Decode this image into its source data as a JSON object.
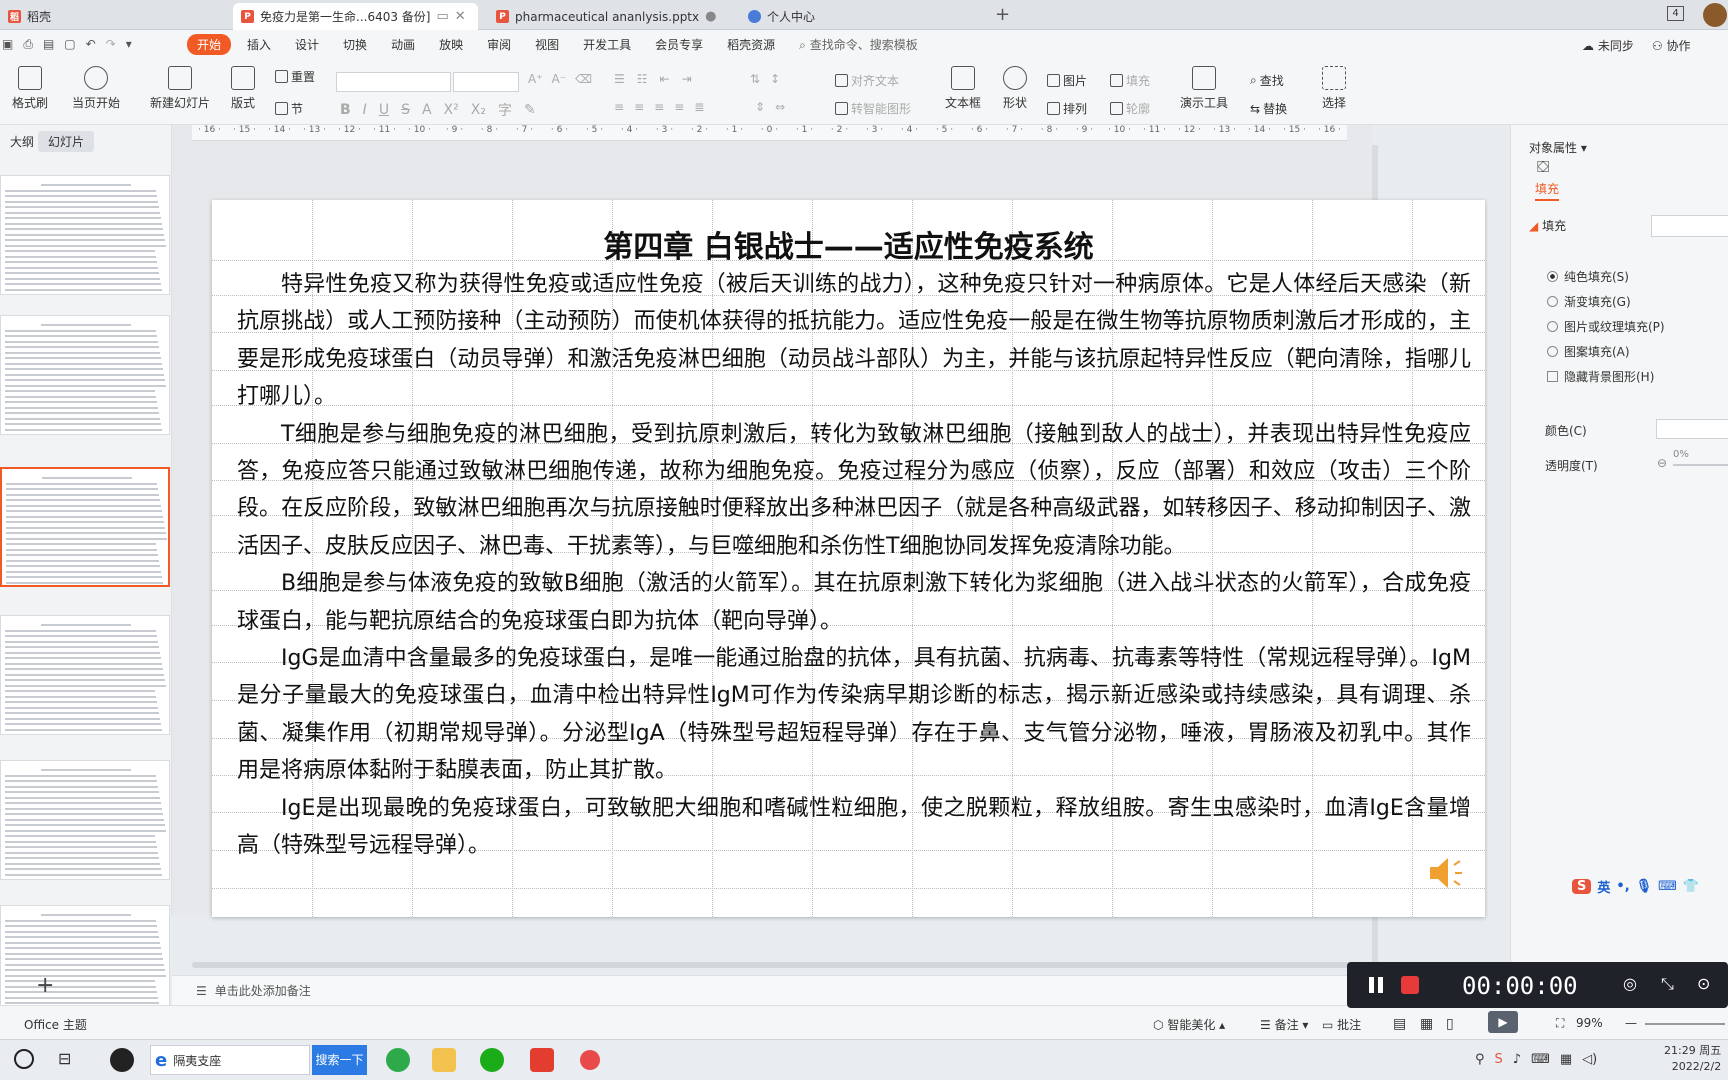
{
  "tabs": [
    {
      "label": "稻壳"
    },
    {
      "label": "免疫力是第一生命...6403 备份]"
    },
    {
      "label": "pharmaceutical ananlysis.pptx"
    },
    {
      "label": "个人中心"
    }
  ],
  "tab_count_badge": "4",
  "menu": [
    "开始",
    "插入",
    "设计",
    "切换",
    "动画",
    "放映",
    "审阅",
    "视图",
    "开发工具",
    "会员专享",
    "稻壳资源"
  ],
  "search_placeholder": "查找命令、搜索模板",
  "sync_label": "未同步",
  "collab_label": "协作",
  "ribbon": {
    "format_brush": "格式刷",
    "from_current": "当页开始",
    "new_slide": "新建幻灯片",
    "layout": "版式",
    "section": "节",
    "reset": "重置",
    "align_text": "对齐文本",
    "smart_shape": "转智能图形",
    "textbox": "文本框",
    "shape": "形状",
    "picture": "图片",
    "fill": "填充",
    "arrange": "排列",
    "outline": "轮廓",
    "present_tools": "演示工具",
    "find": "查找",
    "replace": "替换",
    "select": "选择"
  },
  "left_tabs": [
    "大纲",
    "幻灯片"
  ],
  "slide": {
    "title": "第四章  白银战士——适应性免疫系统",
    "paragraphs": [
      "特异性免疫又称为获得性免疫或适应性免疫（被后天训练的战力），这种免疫只针对一种病原体。它是人体经后天感染（新抗原挑战）或人工预防接种（主动预防）而使机体获得的抵抗能力。适应性免疫一般是在微生物等抗原物质刺激后才形成的，主要是形成免疫球蛋白（动员导弹）和激活免疫淋巴细胞（动员战斗部队）为主，并能与该抗原起特异性反应（靶向清除，指哪儿打哪儿）。",
      "T细胞是参与细胞免疫的淋巴细胞，受到抗原刺激后，转化为致敏淋巴细胞（接触到敌人的战士），并表现出特异性免疫应答，免疫应答只能通过致敏淋巴细胞传递，故称为细胞免疫。免疫过程分为感应（侦察），反应（部署）和效应（攻击）三个阶段。在反应阶段，致敏淋巴细胞再次与抗原接触时便释放出多种淋巴因子（就是各种高级武器，如转移因子、移动抑制因子、激活因子、皮肤反应因子、淋巴毒、干扰素等），与巨噬细胞和杀伤性T细胞协同发挥免疫清除功能。",
      "B细胞是参与体液免疫的致敏B细胞（激活的火箭军）。其在抗原刺激下转化为浆细胞（进入战斗状态的火箭军），合成免疫球蛋白，能与靶抗原结合的免疫球蛋白即为抗体（靶向导弹）。",
      "IgG是血清中含量最多的免疫球蛋白，是唯一能通过胎盘的抗体，具有抗菌、抗病毒、抗毒素等特性（常规远程导弹）。IgM是分子量最大的免疫球蛋白，血清中检出特异性IgM可作为传染病早期诊断的标志，揭示新近感染或持续感染，具有调理、杀菌、凝集作用（初期常规导弹）。分泌型IgA（特殊型号超短程导弹）存在于鼻、支气管分泌物，唾液，胃肠液及初乳中。其作用是将病原体黏附于黏膜表面，防止其扩散。",
      "IgE是出现最晚的免疫球蛋白，可致敏肥大细胞和嗜碱性粒细胞，使之脱颗粒，释放组胺。寄生虫感染时，血清IgE含量增高（特殊型号远程导弹）。"
    ]
  },
  "notes_placeholder": "单击此处添加备注",
  "right_panel": {
    "header": "对象属性",
    "tab": "填充",
    "section": "填充",
    "options": [
      "纯色填充(S)",
      "渐变填充(G)",
      "图片或纹理填充(P)",
      "图案填充(A)"
    ],
    "selected_option": "纯色填充(S)",
    "hide_bg": "隐藏背景图形(H)",
    "color_label": "颜色(C)",
    "transparency_label": "透明度(T)",
    "transparency_value": "0%"
  },
  "status": {
    "theme": "Office 主题",
    "smart_beautify": "智能美化",
    "notes": "备注",
    "comment": "批注",
    "zoom": "99%"
  },
  "recorder": {
    "time": "00:00:00"
  },
  "taskbar": {
    "search_text": "隔夷支座",
    "search_button": "搜索一下",
    "time": "21:29 周五",
    "date": "2022/2/2"
  },
  "ime": {
    "lang": "英"
  },
  "colors": {
    "accent": "#f15a24",
    "ribbon_bg": "#f5f6f7",
    "recorder_bg": "#1f2329"
  }
}
